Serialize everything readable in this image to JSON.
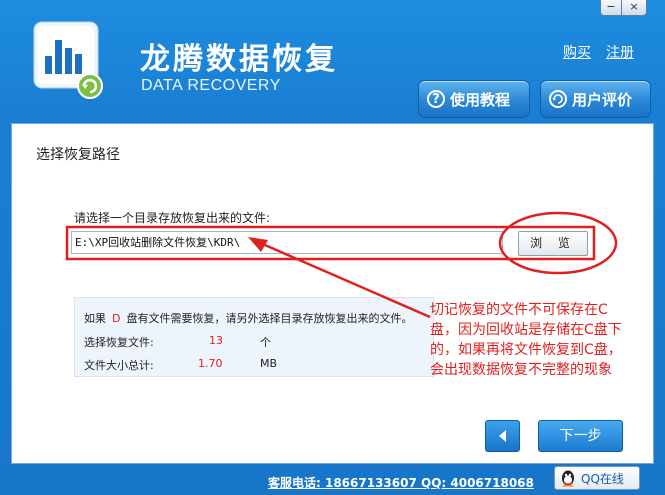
{
  "app": {
    "title_cn": "龙腾数据恢复",
    "title_en": "DATA RECOVERY"
  },
  "window_controls": {
    "minimize": "−",
    "close": "×"
  },
  "top_links": {
    "buy": "购买",
    "register": "注册"
  },
  "header_buttons": {
    "help": {
      "icon": "question-icon",
      "label": "使用教程",
      "glyph": "?"
    },
    "review": {
      "icon": "recycle-icon",
      "label": "用户评价"
    }
  },
  "main": {
    "section_title": "选择恢复路径",
    "prompt": "请选择一个目录存放恢复出来的文件:",
    "path_value": "E:\\XP回收站删除文件恢复\\KDR\\",
    "browse_label": "浏 览",
    "info": {
      "line1_prefix": "如果",
      "drive": "D",
      "line1_suffix": "盘有文件需要恢复，请另外选择目录存放恢复出来的文件。",
      "files_label": "选择恢复文件:",
      "files_value": "13",
      "files_unit": "个",
      "size_label": "文件大小总计:",
      "size_value": "1.70",
      "size_unit": "MB"
    },
    "annotation": "切记恢复的文件不可保存在C盘，因为回收站是存储在C盘下的，如果再将文件恢复到C盘，会出现数据恢复不完整的现象",
    "next_label": "下一步"
  },
  "footer": {
    "contact": "客服电话: 18667133607 QQ: 4006718068",
    "qq_label": "QQ在线"
  },
  "colors": {
    "header_blue": "#1a7fd3",
    "annotation_red": "#e0201e"
  }
}
